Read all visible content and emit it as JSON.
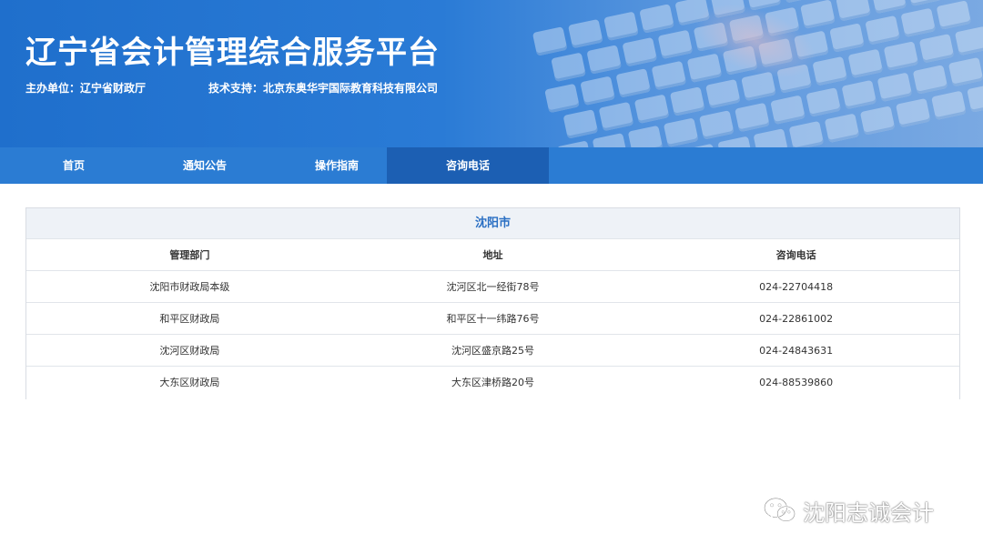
{
  "banner": {
    "title": "辽宁省会计管理综合服务平台",
    "host_label": "主办单位：辽宁省财政厅",
    "tech_label": "技术支持：北京东奥华宇国际教育科技有限公司"
  },
  "nav": {
    "items": [
      {
        "label": "首页"
      },
      {
        "label": "通知公告"
      },
      {
        "label": "操作指南"
      },
      {
        "label": "咨询电话"
      }
    ],
    "active": "咨询电话"
  },
  "contacts": {
    "city": "沈阳市",
    "columns": [
      "管理部门",
      "地址",
      "咨询电话"
    ],
    "rows": [
      [
        "沈阳市财政局本级",
        "沈河区北一经街78号",
        "024-22704418"
      ],
      [
        "和平区财政局",
        "和平区十一纬路76号",
        "024-22861002"
      ],
      [
        "沈河区财政局",
        "沈河区盛京路25号",
        "024-24843631"
      ],
      [
        "大东区财政局",
        "大东区津桥路20号",
        "024-88539860"
      ]
    ]
  },
  "watermark": {
    "text": "沈阳志诚会计",
    "icon": "wechat-icon"
  },
  "colors": {
    "banner_blue": "#2a7bd6",
    "nav_blue": "#2b7cd3",
    "nav_active": "#1c5fb3",
    "city_text": "#2a6fc3"
  }
}
